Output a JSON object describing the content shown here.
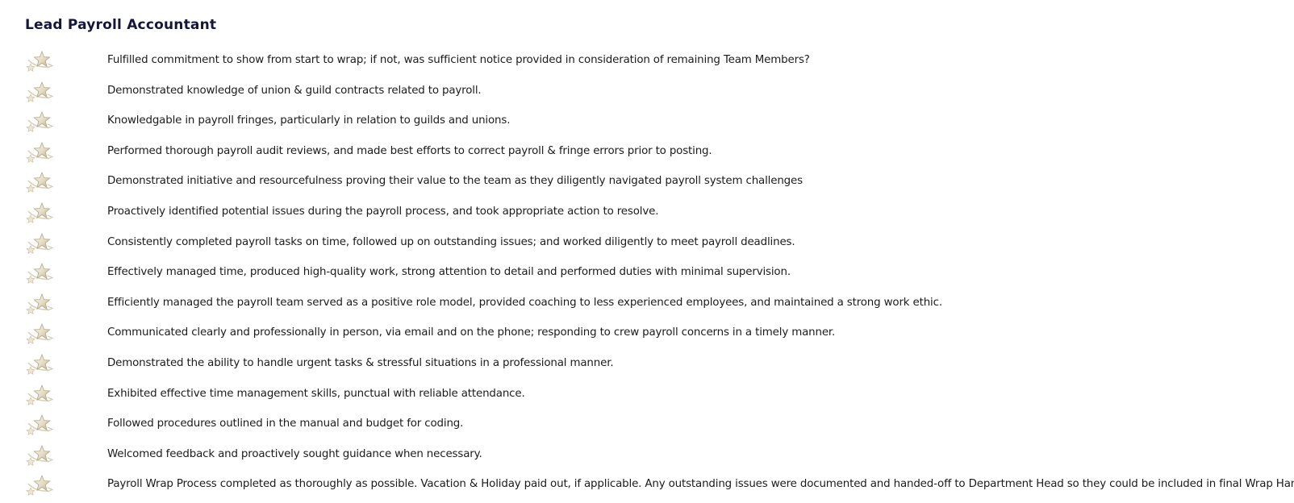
{
  "page_title": "Lead Payroll Accountant",
  "rating_icon": "star-rating-icon",
  "colors": {
    "title": "#15153d",
    "text": "#1b1b1b",
    "star_light": "#f4efe0",
    "star_shadow": "#b9ae8e"
  },
  "criteria": [
    "Fulfilled commitment to show from start to wrap; if not, was sufficient notice provided in consideration of remaining Team Members?",
    "Demonstrated knowledge of union & guild contracts related to payroll.",
    "Knowledgable in payroll fringes, particularly in relation to guilds and unions.",
    "Performed thorough payroll audit reviews, and made best efforts to correct payroll & fringe errors prior to posting.",
    "Demonstrated initiative and resourcefulness proving their value to the team as they diligently navigated payroll system challenges",
    "Proactively identified potential issues during the payroll process, and took appropriate action to resolve.",
    "Consistently completed payroll tasks on time, followed up on outstanding issues; and worked diligently to meet payroll deadlines.",
    "Effectively managed time, produced high-quality work, strong attention to detail and performed duties with minimal supervision.",
    "Efficiently managed the payroll team served as a positive role model, provided coaching to less experienced employees, and maintained a strong work ethic.",
    "Communicated clearly and professionally in person, via email and on the phone; responding to crew payroll concerns in a timely manner.",
    "Demonstrated the ability to handle urgent tasks & stressful situations in a professional manner.",
    "Exhibited effective time management skills, punctual with reliable attendance.",
    "Followed procedures outlined in the manual and budget for coding.",
    "Welcomed feedback and proactively sought guidance when necessary.",
    "Payroll Wrap Process completed as thoroughly as possible. Vacation & Holiday paid out, if applicable. Any outstanding issues were documented and handed-off to Department Head so they could be included in final Wrap Hand-off."
  ]
}
